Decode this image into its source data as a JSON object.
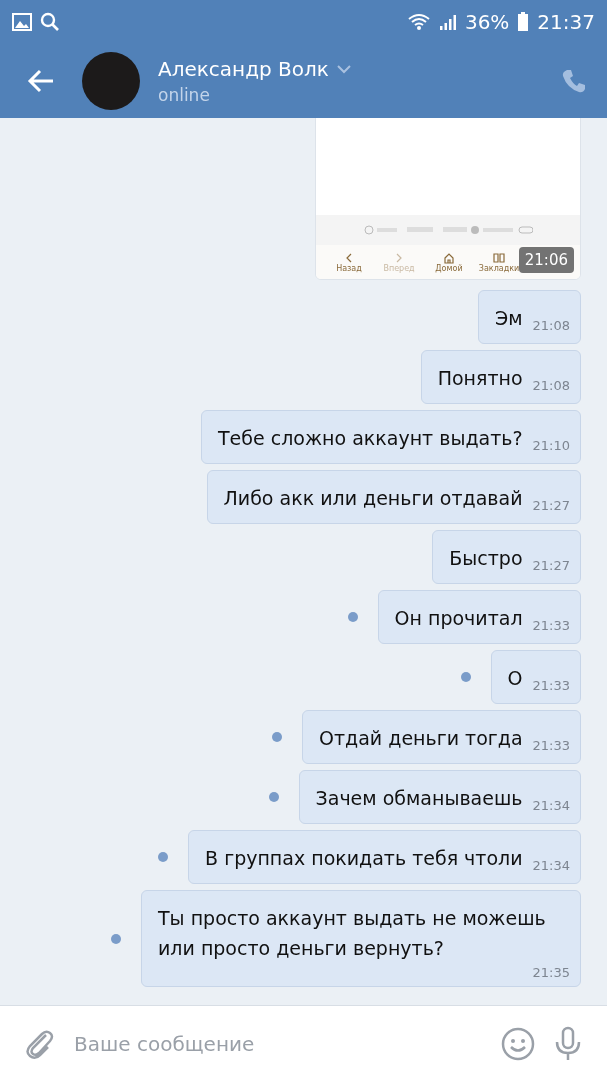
{
  "status_bar": {
    "battery": "36%",
    "time": "21:37"
  },
  "header": {
    "name": "Александр Волк",
    "status": "online"
  },
  "attachment": {
    "nav": [
      {
        "label": "Назад",
        "disabled": false
      },
      {
        "label": "Вперед",
        "disabled": true
      },
      {
        "label": "Домой",
        "disabled": false
      },
      {
        "label": "Закладки",
        "disabled": false
      }
    ],
    "time": "21:06"
  },
  "messages": [
    {
      "text": "Эм",
      "time": "21:08",
      "unread": false
    },
    {
      "text": "Понятно",
      "time": "21:08",
      "unread": false
    },
    {
      "text": "Тебе сложно аккаунт выдать?",
      "time": "21:10",
      "unread": false
    },
    {
      "text": "Либо акк или деньги отдавай",
      "time": "21:27",
      "unread": false
    },
    {
      "text": "Быстро",
      "time": "21:27",
      "unread": false
    },
    {
      "text": "Он прочитал",
      "time": "21:33",
      "unread": true
    },
    {
      "text": "О",
      "time": "21:33",
      "unread": true
    },
    {
      "text": "Отдай деньги тогда",
      "time": "21:33",
      "unread": true
    },
    {
      "text": "Зачем обманываешь",
      "time": "21:34",
      "unread": true
    },
    {
      "text": "В группах покидать тебя чтоли",
      "time": "21:34",
      "unread": true
    },
    {
      "text": "Ты просто аккаунт выдать не можешь или просто деньги вернуть?",
      "time": "21:35",
      "unread": true
    }
  ],
  "composer": {
    "placeholder": "Ваше сообщение"
  }
}
